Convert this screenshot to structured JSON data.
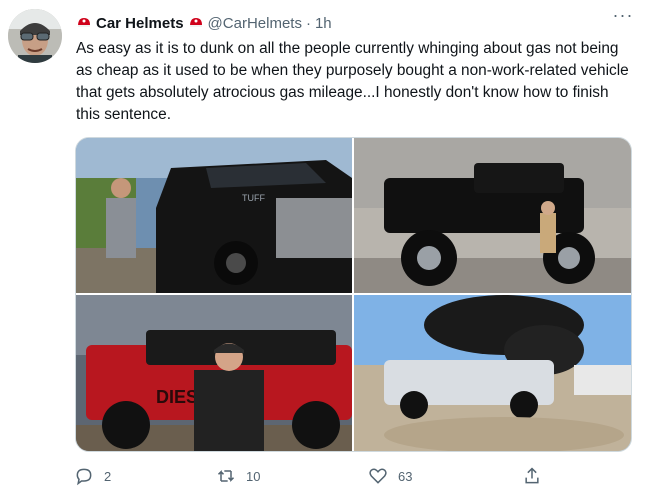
{
  "tweet": {
    "author_name": "Car Helmets",
    "handle": "@CarHelmets",
    "separator": "·",
    "time": "1h",
    "more": "···",
    "text": "As easy as it is to dunk on all the people currently whinging about gas not being as cheap as it used to be when they purposely bought a non-work-related vehicle that gets absolutely atrocious gas mileage...I honestly don't know how to finish this sentence.",
    "media": [
      {
        "label": "TUFF"
      },
      {
        "label": ""
      },
      {
        "label": "DIESEL"
      },
      {
        "label": ""
      }
    ],
    "stats": {
      "replies": "2",
      "retweets": "10",
      "likes": "63"
    }
  },
  "icons": [
    "helmet-icon",
    "more-icon",
    "reply-icon",
    "retweet-icon",
    "like-icon",
    "share-icon"
  ],
  "colors": {
    "muted": "#536471",
    "text": "#0f1419",
    "border": "#cfd9de",
    "helmet_red": "#d0021b"
  }
}
